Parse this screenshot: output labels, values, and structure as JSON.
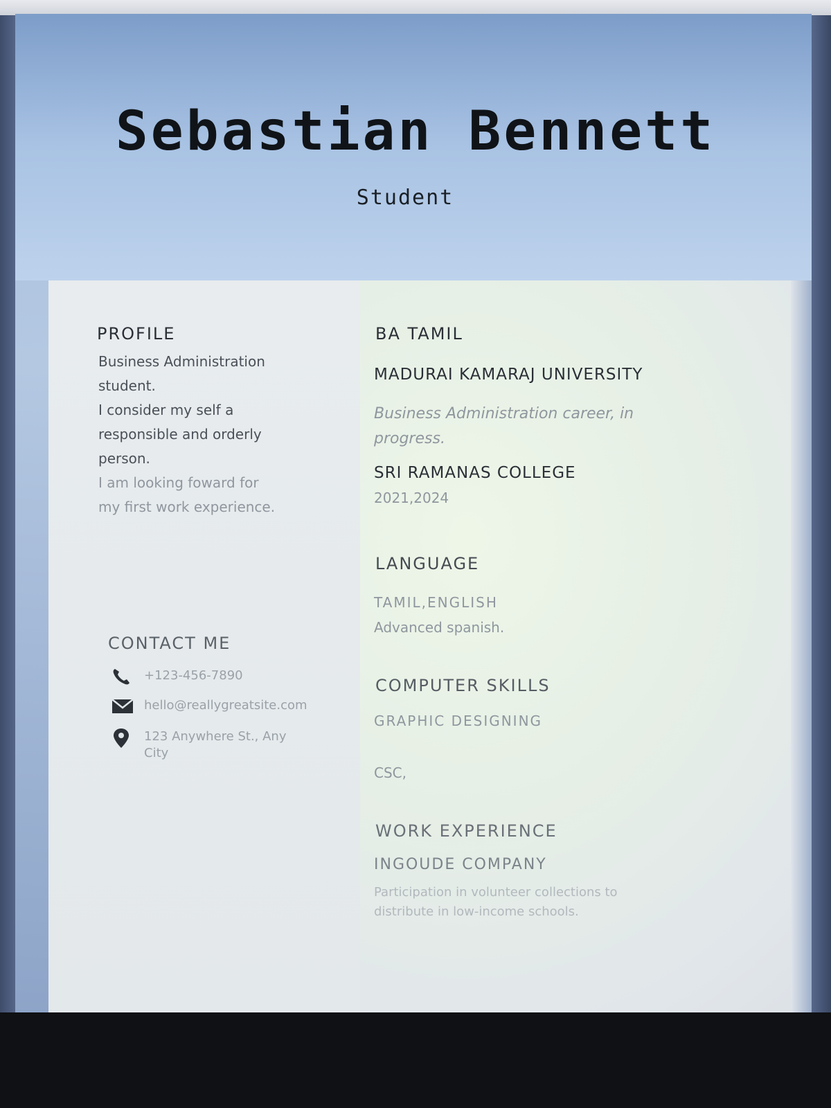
{
  "resume": {
    "name": "Sebastian Bennett",
    "title": "Student"
  },
  "profile": {
    "heading": "PROFILE",
    "lines": [
      "Business Administration",
      "student.",
      "I consider my self a",
      "responsible and orderly",
      "person.",
      "I am looking foward for",
      "my first work experience."
    ]
  },
  "contact": {
    "heading": "CONTACT ME",
    "phone": "+123-456-7890",
    "email": "hello@reallygreatsite.com",
    "address_line1": "123 Anywhere St., Any",
    "address_line2": "City",
    "icons": [
      "phone-icon",
      "mail-icon",
      "location-icon"
    ]
  },
  "education": {
    "degree": "BA TAMIL",
    "university": "MADURAI KAMARAJ UNIVERSITY",
    "career_line1": "Business Administration career, in",
    "career_line2": "progress.",
    "college": "SRI RAMANAS COLLEGE",
    "years": "2021,2024"
  },
  "language": {
    "heading": "LANGUAGE",
    "line1": "TAMIL,ENGLISH",
    "line2": "Advanced spanish."
  },
  "computer_skills": {
    "heading": "COMPUTER SKILLS",
    "item1": "GRAPHIC DESIGNING",
    "item2": "CSC,"
  },
  "work": {
    "heading": "WORK EXPERIENCE",
    "company": "INGOUDE COMPANY",
    "desc_line1": "Participation in volunteer collections to",
    "desc_line2": "distribute in low-income schools."
  },
  "colors": {
    "header_band": "#a9c3e4",
    "body_bg": "#e6efe6",
    "heading_text": "#2a2f36",
    "faded_text": "#8f969e"
  }
}
